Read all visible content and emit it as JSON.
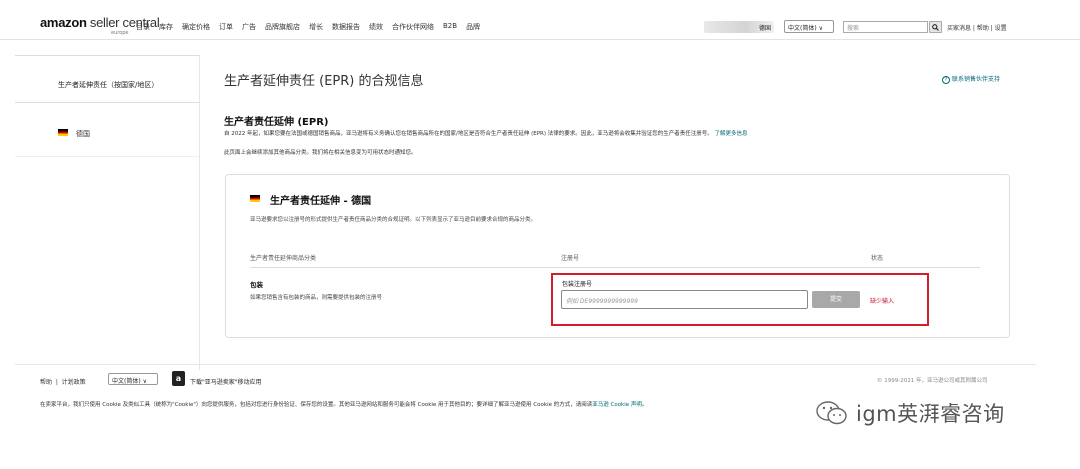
{
  "topbar": {
    "logo_main": "amazon",
    "logo_sc": " seller central",
    "logo_sub": "europe",
    "nav": [
      "目录",
      "库存",
      "确定价格",
      "订单",
      "广告",
      "品牌旗舰店",
      "增长",
      "数据报告",
      "绩效",
      "合作伙伴网络",
      "B2B",
      "品牌"
    ],
    "store_label": "德国",
    "language": "中文(简体) ∨",
    "search_placeholder": "搜索",
    "links": "买家消息 | 帮助 | 设置"
  },
  "sidebar": {
    "header": "生产者延伸责任（按国家/地区）",
    "items": [
      {
        "label": "德国",
        "flag": "germany-flag-icon"
      }
    ]
  },
  "main": {
    "title": "生产者延伸责任 (EPR) 的合规信息",
    "help_link": "联系销售伙伴支持",
    "section_title": "生产者责任延伸 (EPR)",
    "section_desc": "自 2022 年起，如果您要在法国或德国销售商品，亚马逊将有义务确认您在销售商品所在的国家/地区是否符合生产者责任延伸 (EPR) 法律的要求。因此，亚马逊将会收集并验证您的生产者责任注册号。",
    "learn_more": "了解更多信息",
    "section_note": "此页面上会继续添加其他商品分类。我们将在相关信息变为可用状态时通知您。",
    "card": {
      "title": "生产者责任延伸 - 德国",
      "desc": "亚马逊要求您以注册号的形式提供生产者责任商品分类的合规证明。以下列表显示了亚马逊目前要求合规的商品分类。",
      "col_category": "生产者责任延伸商品分类",
      "col_reg": "注册号",
      "col_status": "状态",
      "row": {
        "title": "包装",
        "desc": "如果您销售含有包装的商品，则需要提供包装的注册号",
        "reg_label": "包装注册号",
        "reg_placeholder": "例如 DE9999999999999",
        "submit": "提交",
        "status": "缺少输入"
      }
    }
  },
  "footer": {
    "help": "帮助",
    "plans": "计划政策",
    "language": "中文(简体) ∨",
    "app_text": "下载\"亚马逊卖家\"移动应用",
    "copyright": "© 1999-2021 年，亚马逊公司或其附属公司",
    "cookie_text": "在卖家平台，我们只使用 Cookie 及类似工具（统称为\"Cookie\"）向您提供服务，包括对您进行身份验证、保存您的设置。其他亚马逊网站和服务可能会将 Cookie 用于其他目的；要详细了解亚马逊使用 Cookie 的方式，请阅读",
    "cookie_link": "亚马逊 Cookie 声明",
    "cookie_end": "。"
  },
  "watermark": {
    "text": "igm英湃睿咨询",
    "icon": "wechat-icon"
  },
  "colors": {
    "accent_link": "#006878",
    "error_red": "#d21e2a",
    "status_red": "#c7162b"
  }
}
